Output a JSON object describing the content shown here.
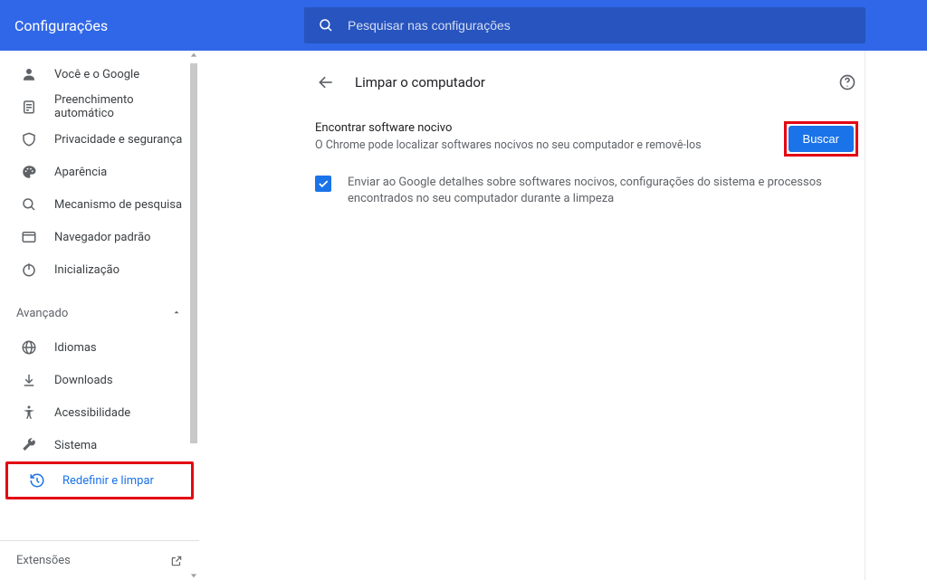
{
  "header": {
    "title": "Configurações",
    "search_placeholder": "Pesquisar nas configurações"
  },
  "sidebar": {
    "items": [
      {
        "icon": "person",
        "label": "Você e o Google"
      },
      {
        "icon": "assignment",
        "label": "Preenchimento automático"
      },
      {
        "icon": "shield",
        "label": "Privacidade e segurança"
      },
      {
        "icon": "palette",
        "label": "Aparência"
      },
      {
        "icon": "search",
        "label": "Mecanismo de pesquisa"
      },
      {
        "icon": "browser",
        "label": "Navegador padrão"
      },
      {
        "icon": "power",
        "label": "Inicialização"
      }
    ],
    "advanced_label": "Avançado",
    "advanced_items": [
      {
        "icon": "globe",
        "label": "Idiomas"
      },
      {
        "icon": "download",
        "label": "Downloads"
      },
      {
        "icon": "accessibility",
        "label": "Acessibilidade"
      },
      {
        "icon": "wrench",
        "label": "Sistema"
      },
      {
        "icon": "restore",
        "label": "Redefinir e limpar",
        "active": true,
        "highlighted": true
      }
    ],
    "footer_label": "Extensões"
  },
  "main": {
    "page_title": "Limpar o computador",
    "find_software": {
      "heading": "Encontrar software nocivo",
      "sub": "O Chrome pode localizar softwares nocivos no seu computador e removê-los",
      "button": "Buscar"
    },
    "report_checkbox": {
      "checked": true,
      "label": "Enviar ao Google detalhes sobre softwares nocivos, configurações do sistema e processos encontrados no seu computador durante a limpeza"
    }
  }
}
